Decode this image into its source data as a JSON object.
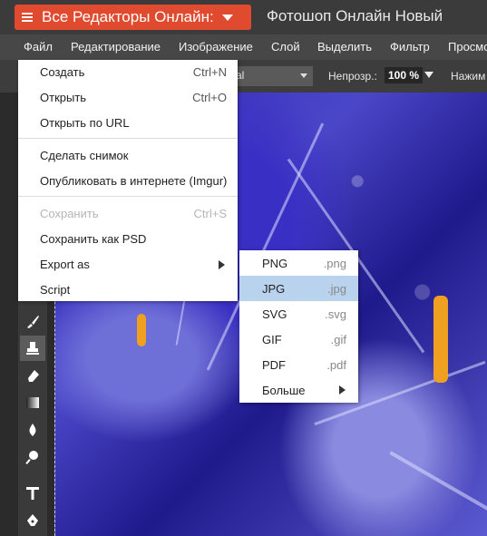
{
  "banner": {
    "editors_button": "Все Редакторы Онлайн:",
    "app_title": "Фотошоп Онлайн Новый"
  },
  "menubar": {
    "items": [
      "Файл",
      "Редактирование",
      "Изображение",
      "Слой",
      "Выделить",
      "Фильтр",
      "Просмо"
    ]
  },
  "options": {
    "blend_mode": "rmal",
    "opacity_label": "Непрозр.:",
    "opacity_value": "100 %",
    "press_label": "Нажим"
  },
  "file_menu": {
    "items": [
      {
        "label": "Создать",
        "shortcut": "Ctrl+N",
        "disabled": false
      },
      {
        "label": "Открыть",
        "shortcut": "Ctrl+O",
        "disabled": false
      },
      {
        "label": "Открыть по URL",
        "shortcut": "",
        "disabled": false
      },
      {
        "label": "Сделать снимок",
        "shortcut": "",
        "disabled": false
      },
      {
        "label": "Опубликовать в интернете (Imgur)",
        "shortcut": "",
        "disabled": false
      },
      {
        "label": "Сохранить",
        "shortcut": "Ctrl+S",
        "disabled": true
      },
      {
        "label": "Сохранить как PSD",
        "shortcut": "",
        "disabled": false
      },
      {
        "label": "Export as",
        "shortcut": "",
        "disabled": false,
        "submenu": true
      },
      {
        "label": "Script",
        "shortcut": "",
        "disabled": false
      }
    ]
  },
  "export_submenu": {
    "items": [
      {
        "label": "PNG",
        "ext": ".png"
      },
      {
        "label": "JPG",
        "ext": ".jpg",
        "selected": true
      },
      {
        "label": "SVG",
        "ext": ".svg"
      },
      {
        "label": "GIF",
        "ext": ".gif"
      },
      {
        "label": "PDF",
        "ext": ".pdf"
      },
      {
        "label": "Больше",
        "ext": "",
        "submenu": true
      }
    ]
  },
  "colors": {
    "accent": "#e04b2f",
    "selected_row": "#b9d3ee"
  },
  "tools": [
    "brush-icon",
    "stamp-icon",
    "eraser-icon",
    "gradient-icon",
    "blur-icon",
    "dodge-icon",
    "text-icon",
    "pen-icon"
  ]
}
